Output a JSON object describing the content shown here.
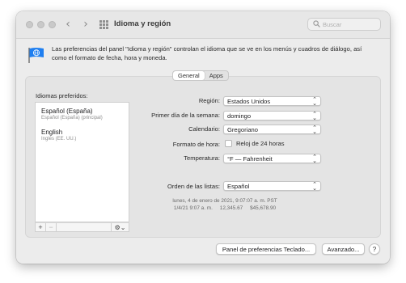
{
  "window": {
    "title": "Idioma y región"
  },
  "toolbar": {
    "search_placeholder": "Buscar",
    "back_icon": "chevron-left",
    "forward_icon": "chevron-right",
    "grid_icon": "show-all-grid"
  },
  "header": {
    "description": "Las preferencias del panel \"Idioma y región\" controlan el idioma que se ve en los menús y cuadros de diálogo, así como el formato de fecha, hora y moneda."
  },
  "tabs": [
    {
      "label": "General",
      "active": true
    },
    {
      "label": "Apps",
      "active": false
    }
  ],
  "languages": {
    "label": "Idiomas preferidos:",
    "items": [
      {
        "name": "Español (España)",
        "sub": "Español (España) (principal)"
      },
      {
        "name": "English",
        "sub": "Inglés (EE. UU.)"
      }
    ],
    "add_label": "+",
    "remove_label": "−",
    "gear_label": "⚙︎⌄"
  },
  "settings": {
    "region": {
      "label": "Región:",
      "value": "Estados Unidos"
    },
    "first_day": {
      "label": "Primer día de la semana:",
      "value": "domingo"
    },
    "calendar": {
      "label": "Calendario:",
      "value": "Gregoriano"
    },
    "time_format": {
      "label": "Formato de hora:",
      "checkbox_label": "Reloj de 24 horas",
      "checked": false
    },
    "temperature": {
      "label": "Temperatura:",
      "value": "°F — Fahrenheit"
    },
    "list_order": {
      "label": "Orden de las listas:",
      "value": "Español"
    }
  },
  "sample": {
    "line1": "lunes, 4 de enero de 2021, 9:07:07 a. m. PST",
    "line2": "1/4/21 9:07 a. m.     12,345.67     $45,678.90"
  },
  "buttons": {
    "keyboard": "Panel de preferencias Teclado...",
    "advanced": "Avanzado...",
    "help": "?"
  },
  "colors": {
    "flag_blue": "#1f7ff0",
    "window_bg": "#ececec",
    "panel_bg": "#e4e4e4"
  }
}
